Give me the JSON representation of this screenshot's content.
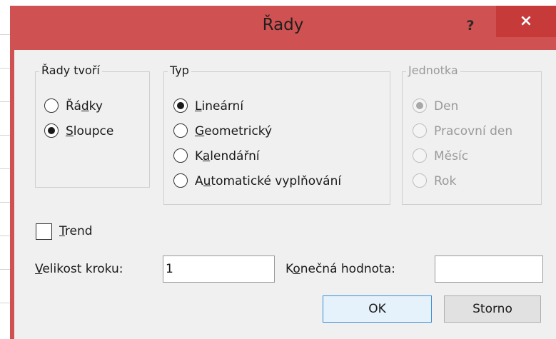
{
  "dialog": {
    "title": "Řady",
    "help_label": "?",
    "close_label": "×"
  },
  "series_in": {
    "legend": "Řady tvoří",
    "options": [
      {
        "pre": "Řá",
        "u": "d",
        "post": "ky",
        "checked": false
      },
      {
        "pre": "",
        "u": "S",
        "post": "loupce",
        "checked": true
      }
    ]
  },
  "type": {
    "legend": "Typ",
    "options": [
      {
        "pre": "",
        "u": "L",
        "post": "ineární",
        "checked": true
      },
      {
        "pre": "",
        "u": "G",
        "post": "eometrický",
        "checked": false
      },
      {
        "pre": "K",
        "u": "a",
        "post": "lendářní",
        "checked": false
      },
      {
        "pre": "A",
        "u": "u",
        "post": "tomatické vyplňování",
        "checked": false
      }
    ]
  },
  "unit": {
    "legend": "Jednotka",
    "disabled": true,
    "options": [
      {
        "label": "Den",
        "checked": true
      },
      {
        "label": "Pracovní den",
        "checked": false
      },
      {
        "label": "Měsíc",
        "checked": false
      },
      {
        "label": "Rok",
        "checked": false
      }
    ]
  },
  "trend": {
    "pre": "",
    "u": "T",
    "post": "rend",
    "checked": false
  },
  "step": {
    "pre": "",
    "u": "V",
    "post": "elikost kroku:",
    "value": "1"
  },
  "stop": {
    "pre": "K",
    "u": "o",
    "post": "nečná hodnota:",
    "value": ""
  },
  "buttons": {
    "ok": "OK",
    "cancel": "Storno"
  }
}
